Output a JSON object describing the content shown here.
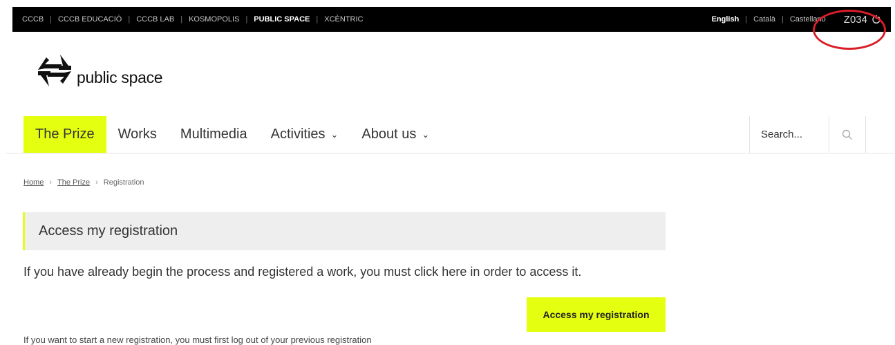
{
  "topbar": {
    "links": [
      {
        "label": "CCCB",
        "active": false
      },
      {
        "label": "CCCB EDUCACIÓ",
        "active": false
      },
      {
        "label": "CCCB LAB",
        "active": false
      },
      {
        "label": "KOSMOPOLIS",
        "active": false
      },
      {
        "label": "PUBLIC SPACE",
        "active": true
      },
      {
        "label": "XCÈNTRIC",
        "active": false
      }
    ],
    "languages": [
      {
        "label": "English",
        "active": true
      },
      {
        "label": "Català",
        "active": false
      },
      {
        "label": "Castellano",
        "active": false
      }
    ],
    "user_code": "Z034"
  },
  "logo": {
    "text": "public space"
  },
  "nav": {
    "items": [
      {
        "label": "The Prize",
        "active": true,
        "dropdown": false
      },
      {
        "label": "Works",
        "active": false,
        "dropdown": false
      },
      {
        "label": "Multimedia",
        "active": false,
        "dropdown": false
      },
      {
        "label": "Activities",
        "active": false,
        "dropdown": true
      },
      {
        "label": "About us",
        "active": false,
        "dropdown": true
      }
    ],
    "search_placeholder": "Search..."
  },
  "breadcrumb": {
    "home": "Home",
    "prize": "The Prize",
    "current": "Registration"
  },
  "access": {
    "title": "Access my registration",
    "description": "If you have already begin the process and registered a work, you must click here in order to access it.",
    "button_label": "Access my registration",
    "logout_note": "If you want to start a new registration, you must first log out of your previous registration"
  },
  "colors": {
    "accent": "#e4ff10",
    "topbar_bg": "#000000",
    "annotation": "#d81e27"
  }
}
